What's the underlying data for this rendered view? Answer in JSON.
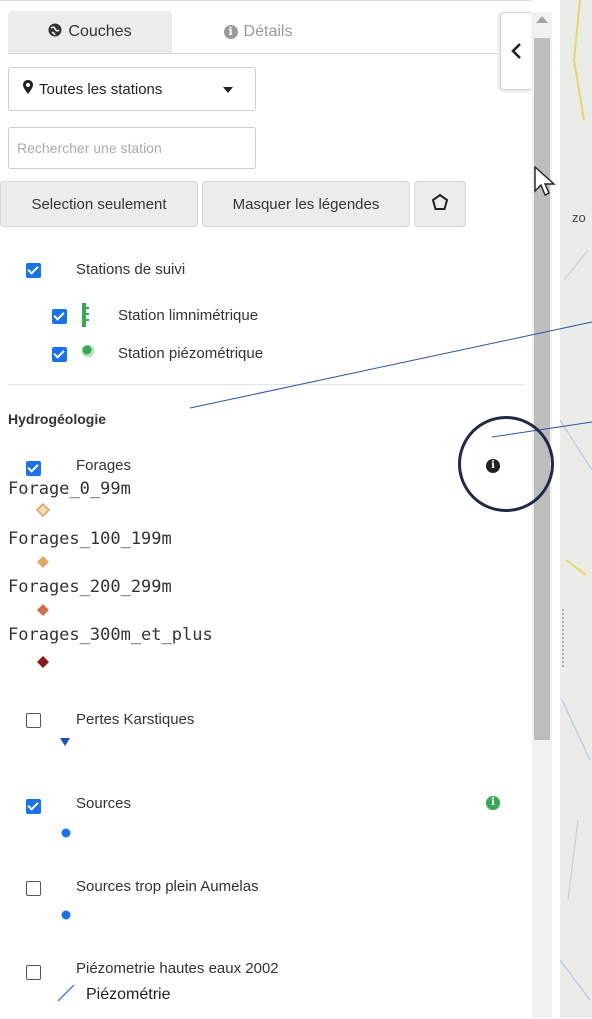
{
  "tabs": [
    {
      "label": "Couches",
      "icon": "globe-icon"
    },
    {
      "label": "Détails",
      "icon": "info-icon"
    }
  ],
  "station_select": {
    "value": "Toutes les stations",
    "icon": "map-pin-icon"
  },
  "search": {
    "placeholder": "Rechercher une station"
  },
  "buttons": {
    "selection_only": "Selection seulement",
    "hide_legends": "Masquer les légendes",
    "polygon": "polygon-icon"
  },
  "layers": {
    "stations": {
      "label": "Stations de suivi",
      "checked": true,
      "children": [
        {
          "label": "Station limnimétrique",
          "checked": true,
          "icon": "limnimetric-bars-icon",
          "color": "#34a853"
        },
        {
          "label": "Station piézométrique",
          "checked": true,
          "icon": "green-dot-icon",
          "color": "#34a853"
        }
      ]
    },
    "section_title": "Hydrogéologie",
    "forages": {
      "label": "Forages",
      "checked": true,
      "legend": [
        {
          "label": "Forage_0_99m",
          "color": "#f5deb3"
        },
        {
          "label": "Forages_100_199m",
          "color": "#e3a862"
        },
        {
          "label": "Forages_200_299m",
          "color": "#d2704a"
        },
        {
          "label": "Forages_300m_et_plus",
          "color": "#8b1a1a"
        }
      ]
    },
    "pertes": {
      "label": "Pertes Karstiques",
      "checked": false,
      "color": "#1e4fb5"
    },
    "sources": {
      "label": "Sources",
      "checked": true,
      "color": "#1a73e8"
    },
    "sources_trop_plein": {
      "label": "Sources trop plein Aumelas",
      "checked": false,
      "color": "#1a73e8"
    },
    "piezometrie": {
      "label": "Piézometrie hautes eaux 2002",
      "checked": false,
      "legend_label": "Piézométrie",
      "color": "#6b8fd6"
    }
  },
  "map": {
    "partial_label": "zo"
  },
  "colors": {
    "accent": "#1a73e8",
    "info_green": "#34a853",
    "annotation": "#1f2a44"
  }
}
